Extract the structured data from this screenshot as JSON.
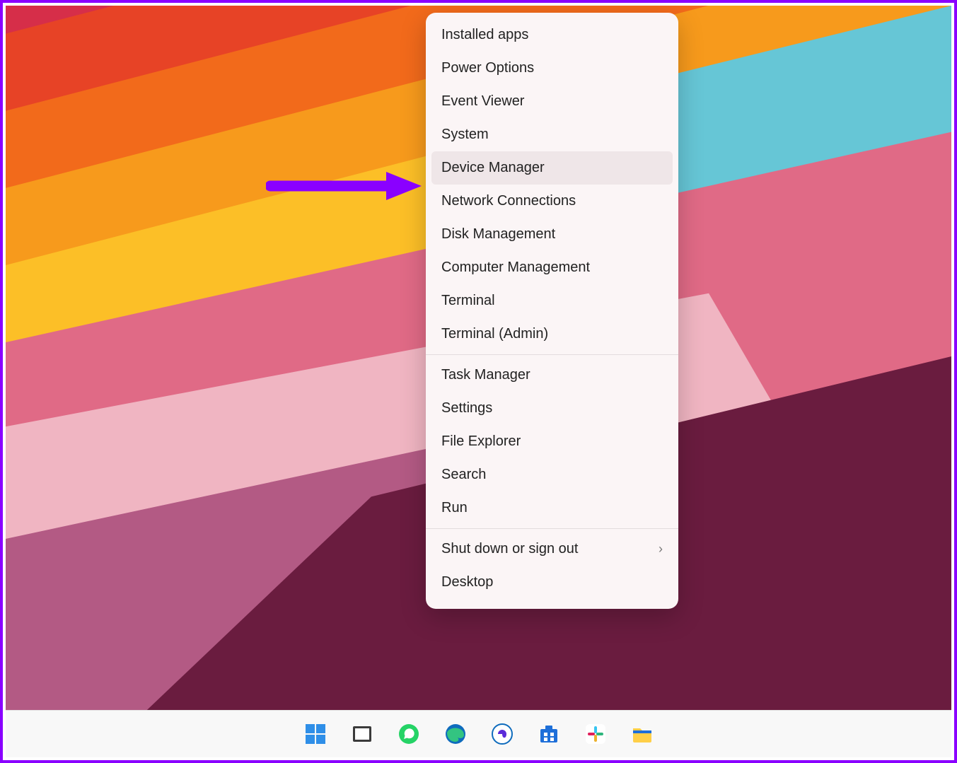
{
  "context_menu": {
    "groups": [
      [
        "Installed apps",
        "Power Options",
        "Event Viewer",
        "System",
        "Device Manager",
        "Network Connections",
        "Disk Management",
        "Computer Management",
        "Terminal",
        "Terminal (Admin)"
      ],
      [
        "Task Manager",
        "Settings",
        "File Explorer",
        "Search",
        "Run"
      ],
      [
        "Shut down or sign out",
        "Desktop"
      ]
    ],
    "highlighted_item": "Device Manager",
    "submenu_item": "Shut down or sign out"
  },
  "taskbar": {
    "icons": [
      "start",
      "task-view",
      "whatsapp",
      "edge",
      "apps",
      "microsoft-store",
      "slack",
      "file-explorer"
    ]
  },
  "annotation": {
    "arrow_color": "#8a00ff",
    "points_to": "Device Manager"
  }
}
